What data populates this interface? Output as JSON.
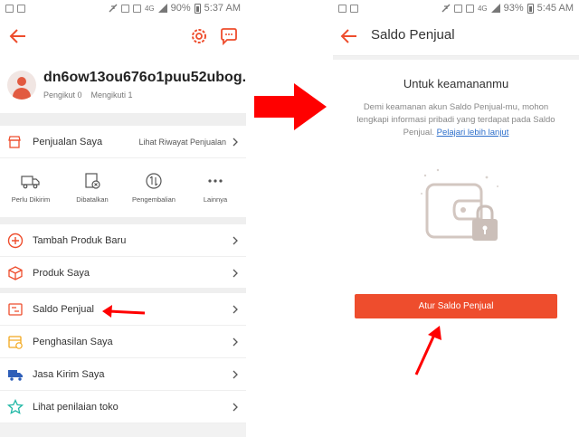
{
  "left_screen": {
    "status_bar": {
      "battery": "90%",
      "time": "5:37 AM",
      "network": "4G"
    },
    "username": "dn6ow13ou676o1puu52ubog...",
    "followers": "Pengikut 0",
    "following": "Mengikuti 1",
    "sales": {
      "label": "Penjualan Saya",
      "history_link": "Lihat Riwayat Penjualan",
      "statuses": [
        "Perlu Dikirim",
        "Dibatalkan",
        "Pengembalian",
        "Lainnya"
      ]
    },
    "menu": {
      "add_product": "Tambah Produk Baru",
      "my_products": "Produk Saya",
      "seller_balance": "Saldo Penjual",
      "my_income": "Penghasilan Saya",
      "my_shipping": "Jasa Kirim Saya",
      "shop_rating": "Lihat penilaian toko"
    }
  },
  "right_screen": {
    "status_bar": {
      "battery": "93%",
      "time": "5:45 AM",
      "network": "4G"
    },
    "title": "Saldo Penjual",
    "security_title": "Untuk keamananmu",
    "security_desc": "Demi keamanan akun Saldo Penjual-mu, mohon lengkapi informasi pribadi yang terdapat pada Saldo Penjual.",
    "learn_more": "Pelajari lebih lanjut",
    "cta_label": "Atur Saldo Penjual"
  },
  "colors": {
    "accent": "#ee4d2d",
    "annotation_red": "#ff0000",
    "link": "#2d6fcb"
  }
}
